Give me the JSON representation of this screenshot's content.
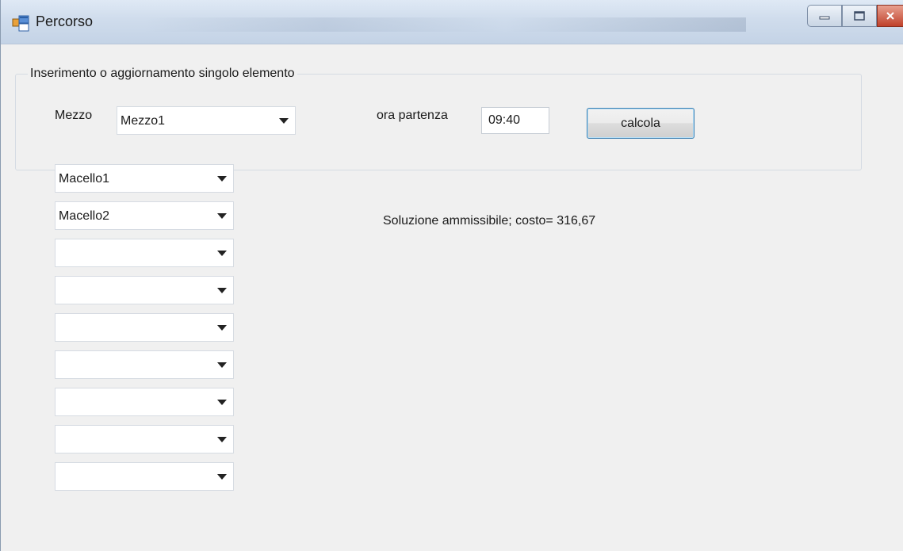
{
  "window": {
    "title": "Percorso",
    "controls": [
      "minimize-icon",
      "maximize-icon",
      "close-icon"
    ]
  },
  "group": {
    "legend": "Inserimento o aggiornamento singolo elemento",
    "mezzo_label": "Mezzo",
    "mezzo_value": "Mezzo1",
    "ora_label": "ora partenza",
    "ora_value": "09:40",
    "calcola_label": "calcola"
  },
  "stops": [
    {
      "value": "Macello1"
    },
    {
      "value": "Macello2"
    },
    {
      "value": ""
    },
    {
      "value": ""
    },
    {
      "value": ""
    },
    {
      "value": ""
    },
    {
      "value": ""
    },
    {
      "value": ""
    },
    {
      "value": ""
    }
  ],
  "result": "Soluzione ammissibile; costo= 316,67",
  "colors": {
    "button_border": "#3c7fb1",
    "background": "#f0f0f0"
  }
}
